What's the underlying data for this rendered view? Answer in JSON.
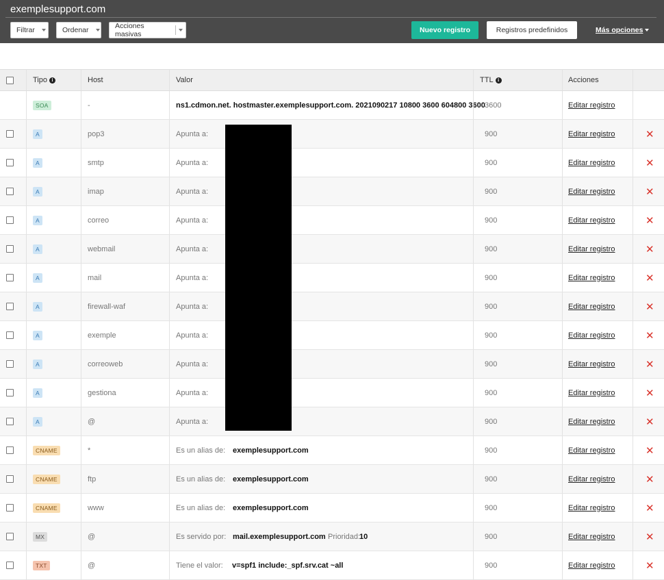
{
  "header": {
    "domain": "exemplesupport.com",
    "filter_label": "Filtrar",
    "order_label": "Ordenar",
    "bulk_label": "Acciones masivas",
    "new_record_label": "Nuevo registro",
    "predefined_label": "Registros predefinidos",
    "more_options_label": "Más opciones"
  },
  "table": {
    "columns": {
      "tipo": "Tipo",
      "host": "Host",
      "valor": "Valor",
      "ttl": "TTL",
      "acciones": "Acciones"
    },
    "edit_label": "Editar registro",
    "delete_glyph": "✕",
    "rows": [
      {
        "type": "SOA",
        "host": "-",
        "value_prefix": "",
        "value": "ns1.cdmon.net. hostmaster.exemplesupport.com. 2021090217 10800 3600 604800 3600",
        "extra_label": "",
        "extra_value": "",
        "ttl": "3600"
      },
      {
        "type": "A",
        "host": "pop3",
        "value_prefix": "Apunta a:",
        "value": "",
        "extra_label": "",
        "extra_value": "",
        "ttl": "900"
      },
      {
        "type": "A",
        "host": "smtp",
        "value_prefix": "Apunta a:",
        "value": "",
        "extra_label": "",
        "extra_value": "",
        "ttl": "900"
      },
      {
        "type": "A",
        "host": "imap",
        "value_prefix": "Apunta a:",
        "value": "",
        "extra_label": "",
        "extra_value": "",
        "ttl": "900"
      },
      {
        "type": "A",
        "host": "correo",
        "value_prefix": "Apunta a:",
        "value": "",
        "extra_label": "",
        "extra_value": "",
        "ttl": "900"
      },
      {
        "type": "A",
        "host": "webmail",
        "value_prefix": "Apunta a:",
        "value": "",
        "extra_label": "",
        "extra_value": "",
        "ttl": "900"
      },
      {
        "type": "A",
        "host": "mail",
        "value_prefix": "Apunta a:",
        "value": "",
        "extra_label": "",
        "extra_value": "",
        "ttl": "900"
      },
      {
        "type": "A",
        "host": "firewall-waf",
        "value_prefix": "Apunta a:",
        "value": "",
        "extra_label": "",
        "extra_value": "",
        "ttl": "900"
      },
      {
        "type": "A",
        "host": "exemple",
        "value_prefix": "Apunta a:",
        "value": "",
        "extra_label": "",
        "extra_value": "",
        "ttl": "900"
      },
      {
        "type": "A",
        "host": "correoweb",
        "value_prefix": "Apunta a:",
        "value": "",
        "extra_label": "",
        "extra_value": "",
        "ttl": "900"
      },
      {
        "type": "A",
        "host": "gestiona",
        "value_prefix": "Apunta a:",
        "value": "",
        "extra_label": "",
        "extra_value": "",
        "ttl": "900"
      },
      {
        "type": "A",
        "host": "@",
        "value_prefix": "Apunta a:",
        "value": "",
        "extra_label": "",
        "extra_value": "",
        "ttl": "900"
      },
      {
        "type": "CNAME",
        "host": "*",
        "value_prefix": "Es un alias de:",
        "value": "exemplesupport.com",
        "extra_label": "",
        "extra_value": "",
        "ttl": "900"
      },
      {
        "type": "CNAME",
        "host": "ftp",
        "value_prefix": "Es un alias de:",
        "value": "exemplesupport.com",
        "extra_label": "",
        "extra_value": "",
        "ttl": "900"
      },
      {
        "type": "CNAME",
        "host": "www",
        "value_prefix": "Es un alias de:",
        "value": "exemplesupport.com",
        "extra_label": "",
        "extra_value": "",
        "ttl": "900"
      },
      {
        "type": "MX",
        "host": "@",
        "value_prefix": "Es servido por:",
        "value": "mail.exemplesupport.com",
        "extra_label": "Prioridad:",
        "extra_value": "10",
        "ttl": "900"
      },
      {
        "type": "TXT",
        "host": "@",
        "value_prefix": "Tiene el valor:",
        "value": "v=spf1 include:_spf.srv.cat ~all",
        "extra_label": "",
        "extra_value": "",
        "ttl": "900"
      }
    ]
  }
}
